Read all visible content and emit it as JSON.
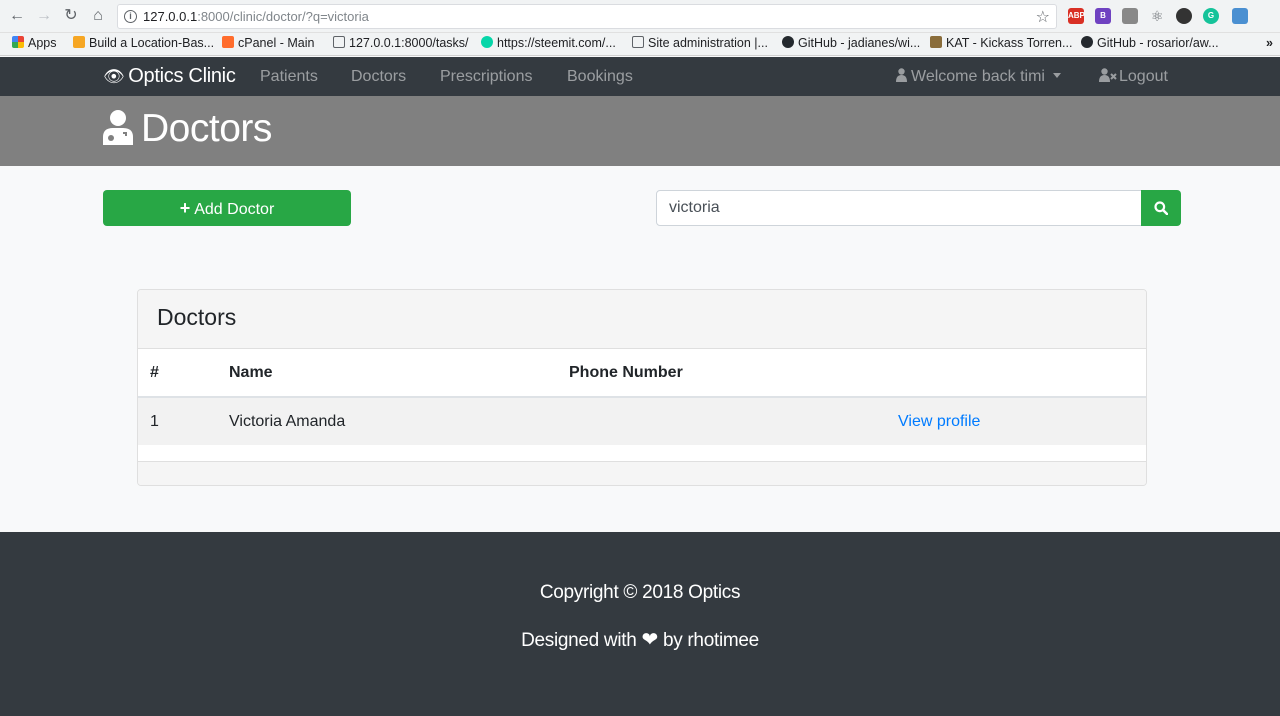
{
  "browser": {
    "url_host": "127.0.0.1",
    "url_rest": ":8000/clinic/doctor/?q=victoria",
    "bookmarks": [
      {
        "label": "Apps"
      },
      {
        "label": "Build a Location-Bas..."
      },
      {
        "label": "cPanel - Main"
      },
      {
        "label": "127.0.0.1:8000/tasks/"
      },
      {
        "label": "https://steemit.com/..."
      },
      {
        "label": "Site administration |..."
      },
      {
        "label": "GitHub - jadianes/wi..."
      },
      {
        "label": "KAT - Kickass Torren..."
      },
      {
        "label": "GitHub - rosarior/aw..."
      }
    ],
    "extensions": [
      "ABP",
      "B",
      "",
      "",
      "",
      "G",
      ""
    ]
  },
  "navbar": {
    "brand": "Optics Clinic",
    "links": [
      "Patients",
      "Doctors",
      "Prescriptions",
      "Bookings"
    ],
    "welcome": "Welcome back timi",
    "logout": "Logout"
  },
  "header": {
    "title": "Doctors"
  },
  "actions": {
    "add_label": "Add Doctor",
    "search_value": "victoria"
  },
  "card": {
    "title": "Doctors",
    "columns": [
      "#",
      "Name",
      "Phone Number"
    ],
    "rows": [
      {
        "num": "1",
        "name": "Victoria Amanda",
        "phone": "",
        "action": "View profile"
      }
    ]
  },
  "footer": {
    "copyright": "Copyright © 2018 Optics",
    "designed_prefix": "Designed with",
    "designed_suffix": "by rhotimee"
  },
  "colors": {
    "navbar": "#343a40",
    "header_band": "#808080",
    "success": "#28a745",
    "link": "#007bff"
  }
}
